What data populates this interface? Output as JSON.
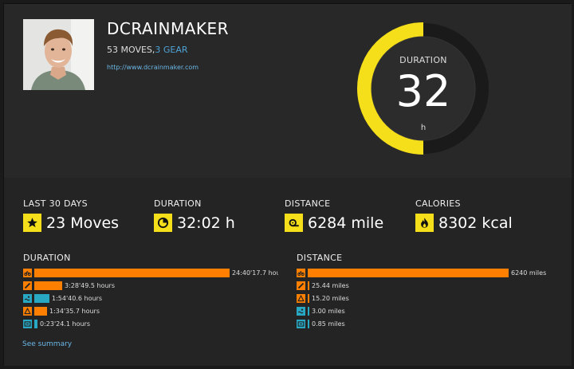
{
  "profile": {
    "username": "DCRAINMAKER",
    "moves_count": "53 MOVES,",
    "gear_count": "3 GEAR",
    "website": "http://www.dcrainmaker.com"
  },
  "gauge": {
    "label": "DURATION",
    "value": "32",
    "unit": "h",
    "fill_fraction": 0.5
  },
  "summary": {
    "moves": {
      "label": "LAST 30 DAYS",
      "value": "23 Moves",
      "icon": "star-icon"
    },
    "duration": {
      "label": "DURATION",
      "value": "32:02 h",
      "icon": "clock-icon"
    },
    "distance": {
      "label": "DISTANCE",
      "value": "6284 mile",
      "icon": "distance-icon"
    },
    "calories": {
      "label": "CALORIES",
      "value": "8302 kcal",
      "icon": "flame-icon"
    }
  },
  "duration_bars": {
    "title": "DURATION",
    "items": [
      {
        "sport": "cycling",
        "icon": "bike-icon",
        "text": "24:40'17.7 hou",
        "fraction": 1.0,
        "color": "#ff7f00"
      },
      {
        "sport": "running",
        "icon": "running-icon",
        "text": "3:28'49.5 hours",
        "fraction": 0.141,
        "color": "#ff7f00"
      },
      {
        "sport": "swimming",
        "icon": "swim-icon",
        "text": "1:54'40.6 hours",
        "fraction": 0.077,
        "color": "#29a8c4"
      },
      {
        "sport": "triathlon",
        "icon": "triathlon-icon",
        "text": "1:34'35.7 hours",
        "fraction": 0.064,
        "color": "#ff7f00"
      },
      {
        "sport": "indoor",
        "icon": "indoor-icon",
        "text": "0:23'24.1 hours",
        "fraction": 0.016,
        "color": "#29a8c4"
      }
    ]
  },
  "distance_bars": {
    "title": "DISTANCE",
    "items": [
      {
        "sport": "cycling",
        "icon": "bike-icon",
        "text": "6240 miles",
        "fraction": 1.0,
        "color": "#ff7f00"
      },
      {
        "sport": "running",
        "icon": "running-icon",
        "text": "25.44 miles",
        "fraction": 0.004,
        "color": "#ff7f00"
      },
      {
        "sport": "triathlon",
        "icon": "triathlon-icon",
        "text": "15.20 miles",
        "fraction": 0.002,
        "color": "#ff7f00"
      },
      {
        "sport": "swimming",
        "icon": "swim-icon",
        "text": "3.00 miles",
        "fraction": 0.0005,
        "color": "#29a8c4"
      },
      {
        "sport": "indoor",
        "icon": "indoor-icon",
        "text": "0.85 miles",
        "fraction": 0.0001,
        "color": "#29a8c4"
      }
    ]
  },
  "links": {
    "see_summary": "See summary"
  },
  "colors": {
    "accent_yellow": "#f5df1a",
    "bar_orange": "#ff7f00",
    "bar_teal": "#29a8c4",
    "link_blue": "#6bb7e6"
  }
}
